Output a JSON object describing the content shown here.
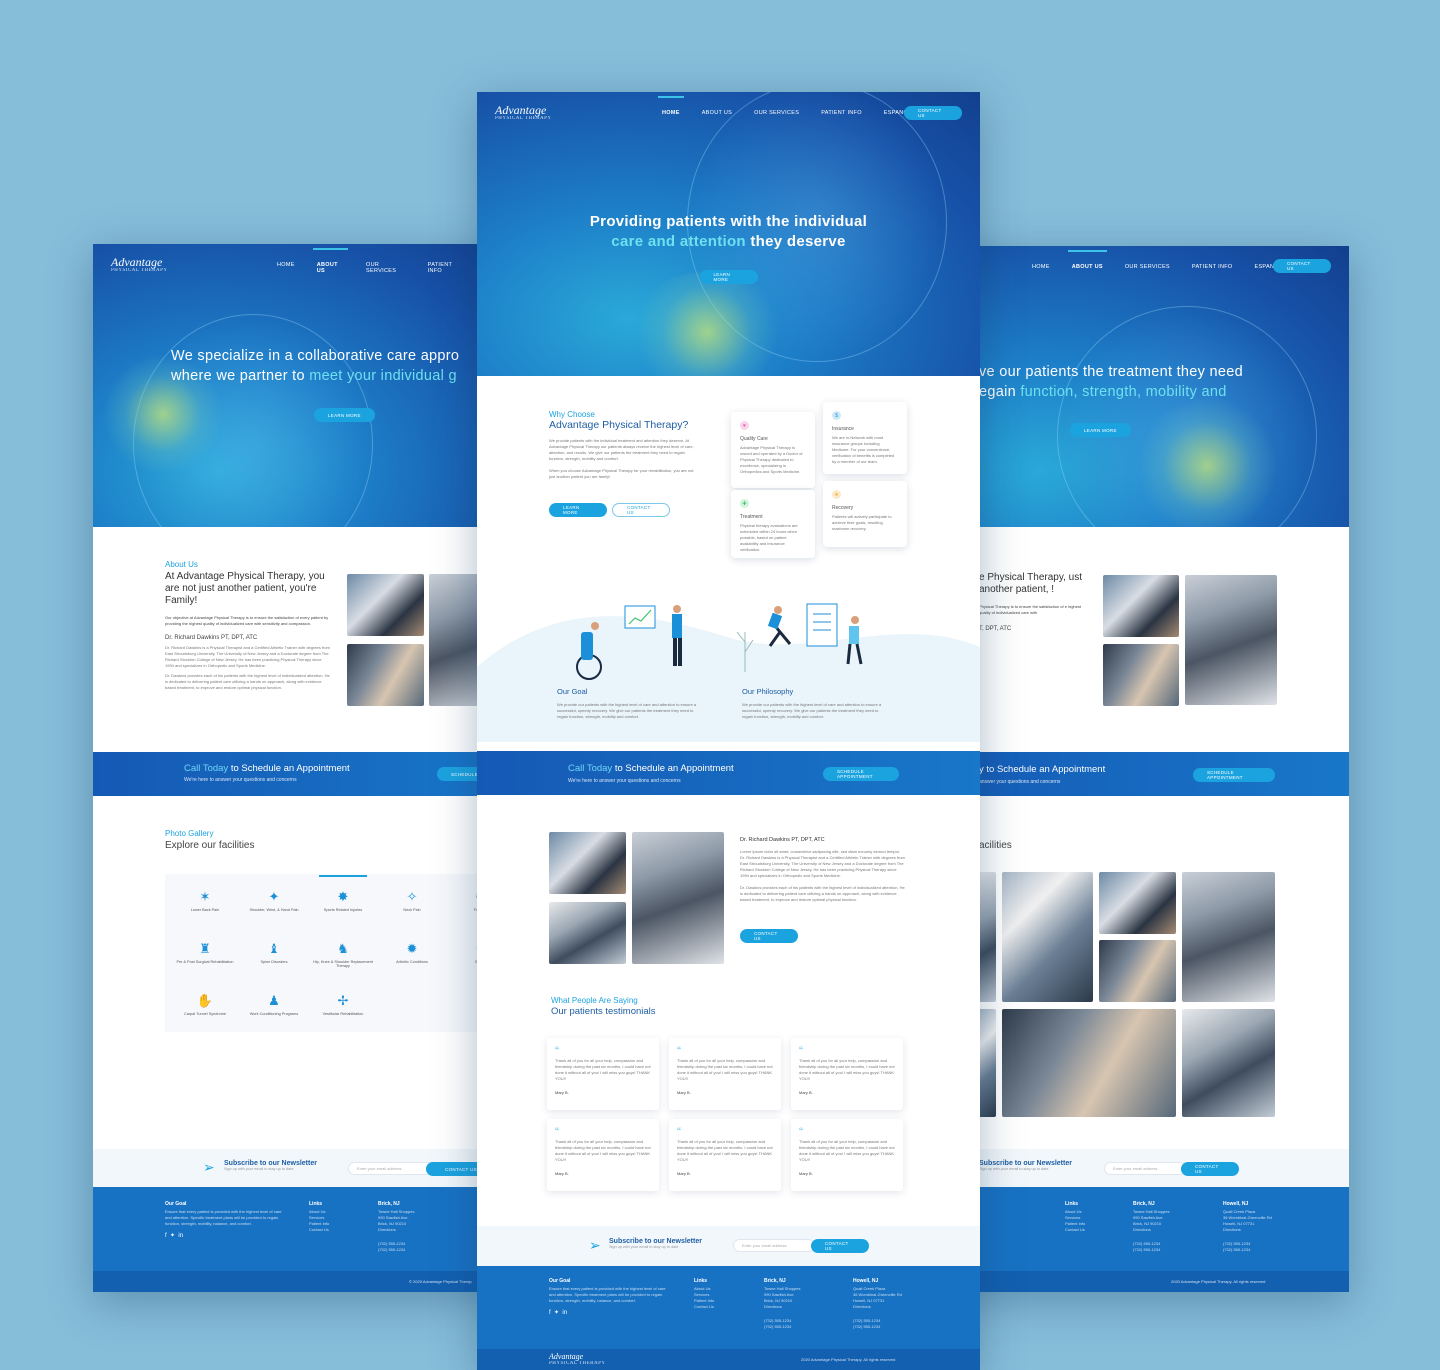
{
  "brand": {
    "logo_line1": "Advantage",
    "logo_line2": "PHYSICAL THERAPY"
  },
  "nav": {
    "items": [
      "HOME",
      "ABOUT US",
      "OUR SERVICES",
      "PATIENT INFO",
      "ESPANOL"
    ],
    "contact": "CONTACT US"
  },
  "left": {
    "hero_line1": "We specialize in a collaborative care appro",
    "hero_line2_pre": "where we partner to ",
    "hero_line2_hl": "meet your individual g",
    "learn_more": "LEARN MORE",
    "about_eyebrow": "About Us",
    "about_title": "At Advantage Physical Therapy, you are not just another patient, you're Family!",
    "about_p1": "Our objective at Advantage Physical Therapy is to ensure the satisfaction of every patient by providing the highest quality of individualized care with sensitivity and compassion.",
    "doctor": "Dr. Richard Dawkins PT, DPT, ATC",
    "about_p2": "Dr. Richard Dawkins is a Physical Therapist and a Certified Athletic Trainer with degrees from East Stroudsburg University, The University of New Jersey and a Doctorate degree from The Richard Stockton College of New Jersey. He has been practicing Physical Therapy since 1994 and specializes in Orthopedic and Sports Medicine.",
    "about_p3": "Dr. Dawkins provides each of his patients with the highest level of individualized attention. He is dedicated to delivering patient care utilizing a hands on approach, along with evidence based treatment, to improve and restore optimal physical function.",
    "cta_hl": "Call Today",
    "cta_rest": " to Schedule an Appointment",
    "cta_sub": "We're here to answer your questions and concerns",
    "cta_btn": "SCHEDULE A",
    "gallery_eyebrow": "Photo Gallery",
    "gallery_title": "Explore our facilities",
    "services": [
      {
        "icon": "lower-back-icon",
        "label": "Lower Back Pain",
        "glyph": "✶"
      },
      {
        "icon": "shoulder-icon",
        "label": "Shoulder, Wrist, & Hand Pain",
        "glyph": "✦"
      },
      {
        "icon": "sports-icon",
        "label": "Sports Related Injuries",
        "glyph": "✸"
      },
      {
        "icon": "neck-icon",
        "label": "Neck Pain",
        "glyph": "✧"
      },
      {
        "icon": "foot-icon",
        "label": "Foot & A",
        "glyph": "✺"
      },
      {
        "icon": "surgical-icon",
        "label": "Pre & Post Surgical Rehabilitation",
        "glyph": "♜"
      },
      {
        "icon": "spine-icon",
        "label": "Spine Disorders",
        "glyph": "♝"
      },
      {
        "icon": "hip-knee-icon",
        "label": "Hip, Knee & Shoulder Replacement Therapy",
        "glyph": "♞"
      },
      {
        "icon": "arthritic-icon",
        "label": "Arthritic Conditions",
        "glyph": "✹"
      },
      {
        "icon": "gait-icon",
        "label": "Gait An",
        "glyph": "✷"
      },
      {
        "icon": "carpal-icon",
        "label": "Carpal Tunnel Syndrome",
        "glyph": "✋"
      },
      {
        "icon": "work-icon",
        "label": "Work Conditioning Programs",
        "glyph": "♟"
      },
      {
        "icon": "vestibular-icon",
        "label": "Vestibular Rehabilitation",
        "glyph": "✢"
      }
    ],
    "newsletter_title": "Subscribe to our Newsletter",
    "newsletter_sub": "Sign up with your email to stay up to date",
    "email_placeholder": "Enter your email address",
    "newsletter_btn": "CONTACT US",
    "footer_goal_title": "Our Goal",
    "footer_goal_text": "Ensure that every patient is provided with the highest level of care and attention. Specific treatment plans will be provided to regain function, strength, mobility, balance, and comfort.",
    "copyright": "© 2020 Advantage Physical Therap"
  },
  "center": {
    "hero_line1": "Providing patients with the individual",
    "hero_line2_hl": "care and attention",
    "hero_line2_rest": " they deserve",
    "learn_more": "LEARN MORE",
    "why_eyebrow": "Why Choose",
    "why_title": "Advantage Physical Therapy?",
    "why_p1": "We provide patients with the individual treatment and attention they deserve. At Advantage Physical Therapy our patients always receive the highest level of care, attention, and results. We give our patients the treatment they need to regain function, strength, mobility and comfort.",
    "why_p2": "When you choose Advantage Physical Therapy for your rehabilitation, you are not just another patient you are family!",
    "btn_learn": "LEARN MORE",
    "btn_contact": "CONTACT US",
    "features": [
      {
        "icon": "heart-icon",
        "glyph": "♥",
        "color": "#e85ab0",
        "title": "Quality Care",
        "text": "Advantage Physical Therapy is owned and operated by a Doctor of Physical Therapy dedicated to excellence, specializing in Orthopedics and Sports Medicine."
      },
      {
        "icon": "insurance-icon",
        "glyph": "$",
        "color": "#2a9de0",
        "title": "Insurance",
        "text": "We are in-Network with most insurance groups including Medicare. For your convenience, verification of benefits is completed by a member of our team."
      },
      {
        "icon": "treatment-icon",
        "glyph": "✚",
        "color": "#3cc46a",
        "title": "Treatment",
        "text": "Physical therapy evaluations are scheduled within 24 hours when possible, based on patient availability and insurance verification."
      },
      {
        "icon": "recovery-icon",
        "glyph": "★",
        "color": "#f2b13a",
        "title": "Recovery",
        "text": "Patients will actively participate to achieve their goals, resulting maximum recovery."
      }
    ],
    "goal_title": "Our Goal",
    "goal_text": "We provide our patients with the highest level of care and attention to ensure a successful, speedy recovery. We give our patients the treatment they need to regain function, strength, mobility and comfort.",
    "philosophy_title": "Our Philosophy",
    "philosophy_text": "We provide our patients with the highest level of care and attention to ensure a successful, speedy recovery. We give our patients the treatment they need to regain function, strength, mobility and comfort.",
    "cta_hl": "Call Today",
    "cta_rest": " to Schedule an Appointment",
    "cta_sub": "We're here to answer your questions and concerns",
    "cta_btn": "SCHEDULE APPOINTMENT",
    "doctor": "Dr. Richard Dawkins PT, DPT, ATC",
    "doc_p1": "Lorem ipsum dolor sit amet, consectetur sadipscing elitr, sed diam nonumy eirmod tempor. Dr. Richard Dawkins is a Physical Therapist and a Certified Athletic Trainer with degrees from East Stroudsburg University, The University of New Jersey and a Doctorate degree from The Richard Stockton College of New Jersey. He has been practicing Physical Therapy since 1994 and specializes in Orthopedic and Sports Medicine.",
    "doc_p2": "Dr. Dawkins provides each of his patients with the highest level of individualized attention. He is dedicated to delivering patient care utilizing a hands on approach, along with evidence based treatment, to improve and restore optimal physical function.",
    "doc_btn": "CONTACT US",
    "testi_eyebrow": "What People Are Saying",
    "testi_title": "Our patients testimonials",
    "testimonials": [
      {
        "text": "Thank all of you for all your help, compassion and friendship during the past six months, I could have not done it without all of you! I will miss you guys! THANK YOU!!",
        "name": "Mary B."
      },
      {
        "text": "Thank all of you for all your help, compassion and friendship during the past six months, I could have not done it without all of you! I will miss you guys! THANK YOU!!",
        "name": "Mary B."
      },
      {
        "text": "Thank all of you for all your help, compassion and friendship during the past six months, I could have not done it without all of you! I will miss you guys! THANK YOU!!",
        "name": "Mary B."
      },
      {
        "text": "Thank all of you for all your help, compassion and friendship during the past six months, I could have not done it without all of you! I will miss you guys! THANK YOU!!",
        "name": "Mary B."
      },
      {
        "text": "Thank all of you for all your help, compassion and friendship during the past six months, I could have not done it without all of you! I will miss you guys! THANK YOU!!",
        "name": "Mary B."
      },
      {
        "text": "Thank all of you for all your help, compassion and friendship during the past six months, I could have not done it without all of you! I will miss you guys! THANK YOU!!",
        "name": "Mary B."
      }
    ],
    "newsletter_title": "Subscribe to our Newsletter",
    "newsletter_sub": "Sign up with your email to stay up to date",
    "email_placeholder": "Enter your email address",
    "newsletter_btn": "CONTACT US",
    "footer": {
      "goal_title": "Our Goal",
      "goal_text": "Ensure that every patient is provided with the highest level of care and attention. Specific treatment plans will be provided to regain function, strength, mobility, balance, and comfort.",
      "links_title": "Links",
      "links": [
        "About Us",
        "Services",
        "Patient Info",
        "Contact Us"
      ],
      "brick_title": "Brick, NJ",
      "brick_lines": [
        "Towne Hall Shoppes",
        "990 Sawfish Ave.",
        "Brick, NJ 90210",
        "Directions"
      ],
      "brick_phones": [
        "(732) 555-1234",
        "(732) 555-1234"
      ],
      "howell_title": "Howell, NJ",
      "howell_lines": [
        "Quail Creek Plaza",
        "36 Wombinal-Greenville Rd",
        "Howell, NJ 07731",
        "Directions"
      ],
      "howell_phones": [
        "(732) 555-1234",
        "(732) 555-1234"
      ],
      "copyright": "2020 Advantage Physical Therapy. All rights reserved"
    }
  },
  "right": {
    "hero_line1": "ve our patients the treatment they need",
    "hero_line2_pre": "egain ",
    "hero_line2_hl": "function, strength, mobility and",
    "learn_more": "LEARN MORE",
    "about_title": "e Physical Therapy, ust another patient, !",
    "about_p1": "Physical Therapy is to ensure the satisfaction of e highest quality of individualized care with",
    "doctor": "T, DPT, ATC",
    "cta_rest": "y to Schedule an Appointment",
    "cta_sub": "answer your questions and concerns",
    "cta_btn": "SCHEDULE APPOINTMENT",
    "gallery_title": "acilities",
    "newsletter_title": "Subscribe to our Newsletter",
    "newsletter_sub": "Sign up with your email to stay up to date",
    "email_placeholder": "Enter your email address",
    "newsletter_btn": "CONTACT US",
    "copyright": "2020 Advantage Physical Therapy. All rights reserved"
  },
  "colors": {
    "background": "#86bdd9",
    "accent": "#1ba3e0",
    "primary": "#1f5ea3",
    "footer": "#1872c4"
  }
}
